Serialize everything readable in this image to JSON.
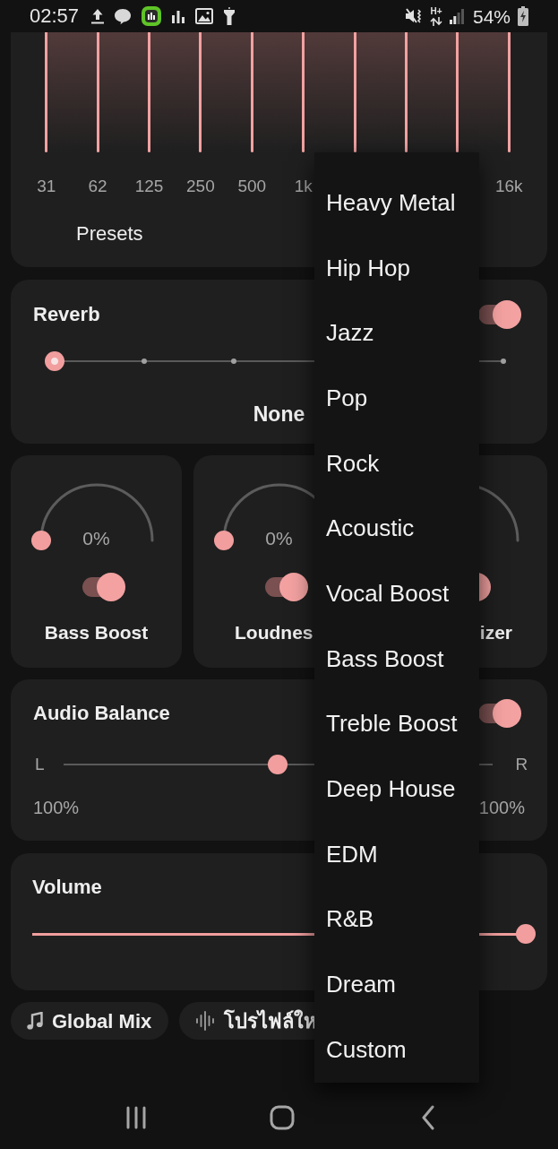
{
  "status_bar": {
    "time": "02:57",
    "network_type": "H+",
    "battery": "54%"
  },
  "equalizer": {
    "bands": [
      {
        "kind": "labeled",
        "label": "31"
      },
      {
        "kind": "labeled",
        "label": "62"
      },
      {
        "kind": "labeled",
        "label": "125"
      },
      {
        "kind": "labeled",
        "label": "250"
      },
      {
        "kind": "labeled",
        "label": "500"
      },
      {
        "kind": "labeled",
        "label": "1k"
      },
      {
        "kind": "covered"
      },
      {
        "kind": "covered"
      },
      {
        "kind": "covered"
      },
      {
        "kind": "labeled",
        "label": "16k"
      }
    ],
    "presets_button": "Presets"
  },
  "reverb": {
    "title": "Reverb",
    "on": true,
    "level": 0,
    "value": "None"
  },
  "effects": [
    {
      "label": "Bass Boost",
      "value": "0%",
      "level": 0,
      "on": true
    },
    {
      "label": "Loudnes",
      "value": "0%",
      "level": 0,
      "on": true
    },
    {
      "label": "izer",
      "on": true
    }
  ],
  "audio_balance": {
    "title": "Audio Balance",
    "on": true,
    "left_label": "L",
    "right_label": "R",
    "level": 0.5,
    "left_value": "100%",
    "right_value": "100%"
  },
  "volume": {
    "title": "Volume",
    "level": 1
  },
  "chips": [
    {
      "kind": "music",
      "label": "Global Mix"
    },
    {
      "kind": "profile",
      "label": "โปรไฟล์ให"
    }
  ],
  "presets_menu": {
    "items": [
      {
        "label": "Heavy Metal",
        "selected": false
      },
      {
        "label": "Hip Hop",
        "selected": false
      },
      {
        "label": "Jazz",
        "selected": false
      },
      {
        "label": "Pop",
        "selected": false
      },
      {
        "label": "Rock",
        "selected": false
      },
      {
        "label": "Acoustic",
        "selected": false
      },
      {
        "label": "Vocal Boost",
        "selected": false
      },
      {
        "label": "Bass Boost",
        "selected": false
      },
      {
        "label": "Treble Boost",
        "selected": false
      },
      {
        "label": "Deep House",
        "selected": false
      },
      {
        "label": "EDM",
        "selected": false
      },
      {
        "label": "R&B",
        "selected": false
      },
      {
        "label": "Dream",
        "selected": false
      },
      {
        "label": "Custom",
        "selected": false
      }
    ]
  }
}
